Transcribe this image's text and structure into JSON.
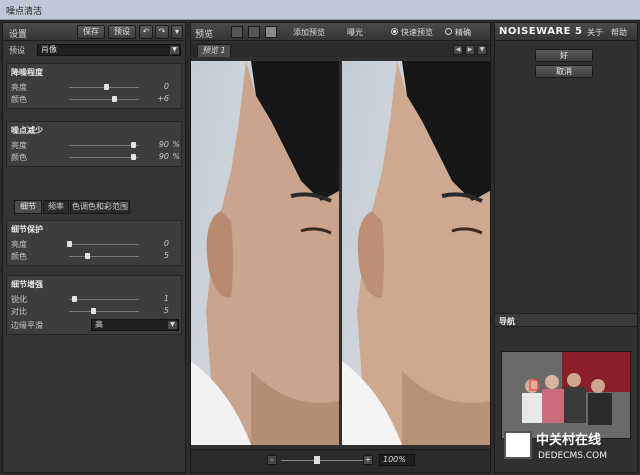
{
  "window": {
    "title": "噪点清洁"
  },
  "left_panel": {
    "title": "设置",
    "save_label": "保存",
    "preset_btn_label": "预设",
    "undo_icon": "undo-icon",
    "redo_icon": "redo-icon",
    "menu_icon": "dropdown-arrow-icon",
    "preset_label": "预设",
    "preset_value": "肖像",
    "noise_level": {
      "title": "降噪程度",
      "rows": [
        {
          "name": "亮度",
          "value": "0",
          "pos": 0.5
        },
        {
          "name": "颜色",
          "value": "+6",
          "pos": 0.62
        }
      ]
    },
    "noise_reduction": {
      "title": "噪点减少",
      "rows": [
        {
          "name": "亮度",
          "value": "90",
          "unit": "%",
          "pos": 0.9
        },
        {
          "name": "颜色",
          "value": "90",
          "unit": "%",
          "pos": 0.9
        }
      ]
    },
    "tabs": [
      "细节",
      "频率",
      "色调色和彩范围"
    ],
    "detail_protection": {
      "title": "细节保护",
      "rows": [
        {
          "name": "亮度",
          "value": "0",
          "pos": 0.0
        },
        {
          "name": "颜色",
          "value": "5",
          "pos": 0.25
        }
      ]
    },
    "detail_enhance": {
      "title": "细节增强",
      "rows": [
        {
          "name": "锐化",
          "value": "1",
          "pos": 0.08
        },
        {
          "name": "对比",
          "value": "5",
          "pos": 0.35
        }
      ],
      "edge_label": "边缘平滑",
      "edge_value": "高"
    }
  },
  "preview": {
    "title": "预览",
    "add_preview": "添加预览",
    "exposure": "曝光",
    "fast_preview": "快速预览",
    "accurate": "精确",
    "fast_selected": true,
    "tab_label": "预览 1",
    "zoom": "100%"
  },
  "right_panel": {
    "brand": "NOISEWARE 5",
    "about": "关于",
    "help": "帮助",
    "ok": "好",
    "cancel": "取消",
    "navigator": "导航"
  },
  "watermark": {
    "line1": "中关村在线",
    "line2": "DEDECMS.COM"
  },
  "colors": {
    "panel": "#343434",
    "frame": "#2b2b2b",
    "accent": "#e4e4e4"
  }
}
